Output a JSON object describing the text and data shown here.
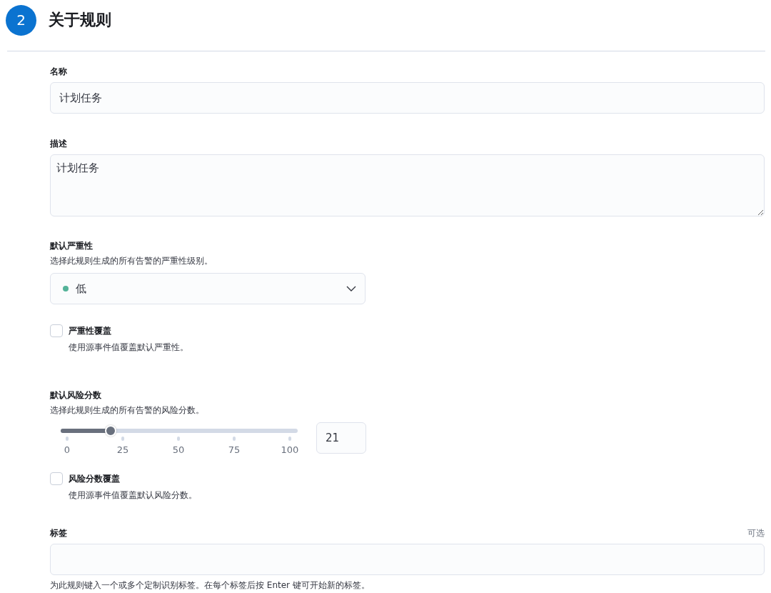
{
  "step": {
    "number": "2",
    "title": "关于规则"
  },
  "fields": [
    {
      "kind": "input",
      "label": "名称",
      "value": "计划任务"
    },
    {
      "kind": "textarea",
      "label": "描述",
      "value": "计划任务"
    },
    {
      "kind": "select",
      "label": "默认严重性",
      "help": "选择此规则生成的所有告警的严重性级别。",
      "value": "低",
      "color": "#54b399"
    },
    {
      "kind": "checkbox",
      "label": "严重性覆盖",
      "help": "使用源事件值覆盖默认严重性。",
      "checked": false
    },
    {
      "kind": "slider",
      "label": "默认风险分数",
      "help": "选择此规则生成的所有告警的风险分数。",
      "level": 0.21,
      "ticks": [
        "0",
        "25",
        "50",
        "75",
        "100"
      ],
      "value": "21"
    },
    {
      "kind": "checkbox",
      "label": "风险分数覆盖",
      "help": "使用源事件值覆盖默认风险分数。",
      "checked": false
    },
    {
      "kind": "tags",
      "label": "标签",
      "optional": "可选",
      "help": "为此规则键入一个或多个定制识别标签。在每个标签后按 Enter 键可开始新的标签。"
    }
  ]
}
